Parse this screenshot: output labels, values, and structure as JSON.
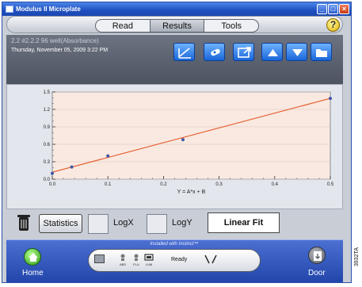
{
  "window": {
    "title": "Modulus II Microplate"
  },
  "tabs": [
    {
      "label": "Read",
      "active": false
    },
    {
      "label": "Results",
      "active": true
    },
    {
      "label": "Tools",
      "active": false
    }
  ],
  "help_label": "?",
  "info": {
    "well": "2.2 #2.2.2 96 well(Absorbance)",
    "date": "Thursday, November 05, 2009 3:22 PM"
  },
  "toolbar_icons": [
    "curve-fit-icon",
    "pipette-icon",
    "export-icon",
    "arrow-up-icon",
    "arrow-down-icon",
    "folder-icon"
  ],
  "chart_data": {
    "type": "scatter",
    "fit": "linear",
    "equation": "Y = A*x + B",
    "x_ticks": [
      "0.0",
      "0.1",
      "0.2",
      "0.3",
      "0.4",
      "0.5"
    ],
    "y_ticks": [
      "0.0",
      "0.3",
      "0.6",
      "0.9",
      "1.2",
      "1.5"
    ],
    "xlim": [
      0,
      0.5
    ],
    "ylim": [
      0,
      1.5
    ],
    "grid": true,
    "points": [
      {
        "x": 0.0,
        "y": 0.1
      },
      {
        "x": 0.035,
        "y": 0.21
      },
      {
        "x": 0.1,
        "y": 0.4
      },
      {
        "x": 0.235,
        "y": 0.68
      },
      {
        "x": 0.5,
        "y": 1.39
      }
    ],
    "fit_line": [
      {
        "x": 0.0,
        "y": 0.12
      },
      {
        "x": 0.5,
        "y": 1.39
      }
    ],
    "colors": {
      "background": "#f9e9e0",
      "line": "#e8592a",
      "points": "#3f57a6"
    }
  },
  "controls": {
    "statistics_label": "Statistics",
    "logx_label": "LogX",
    "logy_label": "LogY",
    "fit_label": "Linear Fit"
  },
  "status": {
    "installed": "Installed with Instinct™",
    "modes": [
      "ABS",
      "FLU",
      "LUM"
    ],
    "ready": "Ready",
    "home_label": "Home",
    "door_label": "Door"
  },
  "side_caption": "3932TA"
}
